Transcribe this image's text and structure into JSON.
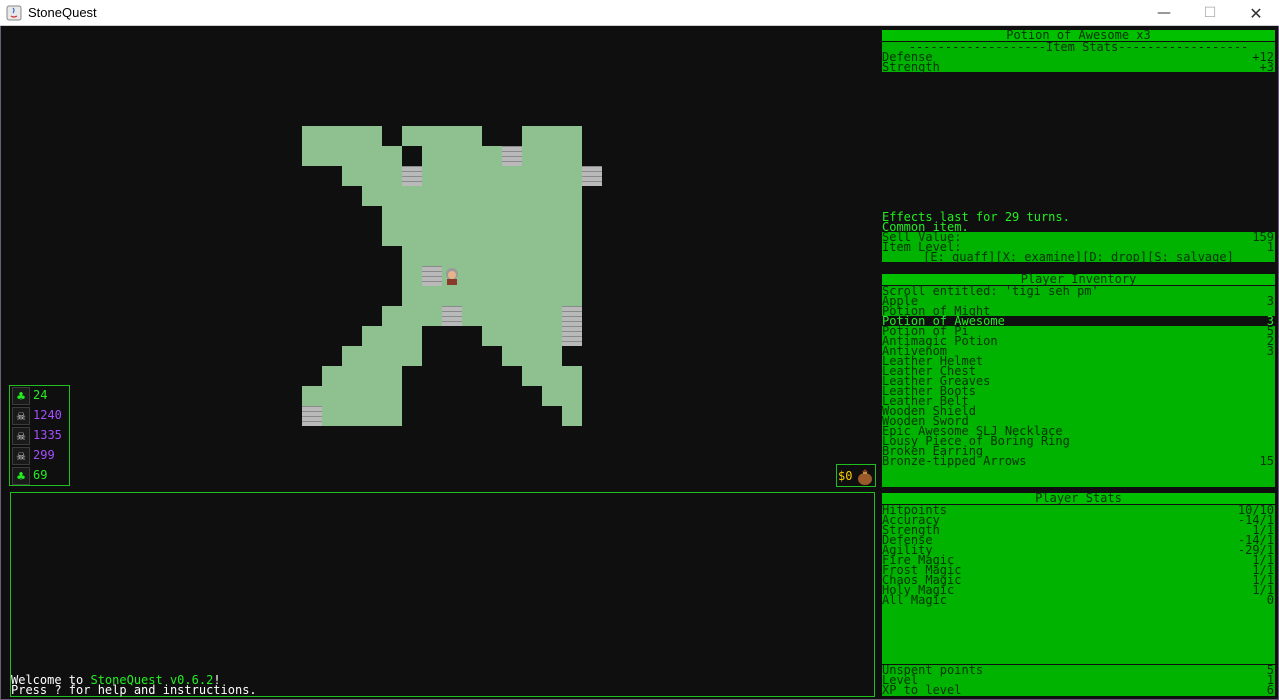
{
  "window": {
    "title": "StoneQuest",
    "minimize_icon": "—",
    "maximize_icon": "☐",
    "close_icon": "✕"
  },
  "status_counters": [
    {
      "icon": "grass-icon",
      "value": "24",
      "color": "#22ee22"
    },
    {
      "icon": "skull-icon",
      "value": "1240",
      "color": "#a64dff"
    },
    {
      "icon": "skull-icon",
      "value": "1335",
      "color": "#a64dff"
    },
    {
      "icon": "skull-icon",
      "value": "299",
      "color": "#a64dff"
    },
    {
      "icon": "grass-icon",
      "value": "69",
      "color": "#22ee22"
    }
  ],
  "gold": {
    "text": "$0"
  },
  "log": {
    "line1_prefix": "Welcome to ",
    "line1_highlight": "StoneQuest v0.6.2",
    "line1_suffix": "!",
    "line2": "Press ? for help and instructions."
  },
  "item_panel": {
    "title": "Potion of Awesome x3",
    "stats_divider": "-------------------Item Stats------------------",
    "stats": [
      {
        "label": "Defense",
        "value": "+12"
      },
      {
        "label": "Strength",
        "value": "+3"
      }
    ],
    "effects": "Effects last for 29 turns.",
    "rarity": "Common item.",
    "sell_label": "Sell Value:",
    "sell_value": "159",
    "level_label": "Item Level:",
    "level_value": "1",
    "actions": "[E: quaff][X: examine][D: drop][S: salvage]"
  },
  "inventory": {
    "title": "Player Inventory",
    "items": [
      {
        "name": "Scroll entitled: 'tigi seh pm'",
        "count": ""
      },
      {
        "name": "Apple",
        "count": "3"
      },
      {
        "name": "Potion of Might",
        "count": ""
      },
      {
        "name": "Potion of Awesome",
        "count": "3"
      },
      {
        "name": "Potion of Pi",
        "count": "5"
      },
      {
        "name": "Antimagic Potion",
        "count": "2"
      },
      {
        "name": "Antivenom",
        "count": "3"
      },
      {
        "name": "Leather Helmet",
        "count": ""
      },
      {
        "name": "Leather Chest",
        "count": ""
      },
      {
        "name": "Leather Greaves",
        "count": ""
      },
      {
        "name": "Leather Boots",
        "count": ""
      },
      {
        "name": "Leather Belt",
        "count": ""
      },
      {
        "name": "Wooden Shield",
        "count": ""
      },
      {
        "name": "Wooden Sword",
        "count": ""
      },
      {
        "name": "Epic Awesome SLJ Necklace",
        "count": ""
      },
      {
        "name": "Lousy Piece of Boring Ring",
        "count": ""
      },
      {
        "name": "Broken Earring",
        "count": ""
      },
      {
        "name": "Bronze-tipped Arrows",
        "count": "15"
      }
    ],
    "selected_index": 3
  },
  "player_stats": {
    "title": "Player Stats",
    "stats": [
      {
        "label": "Hitpoints",
        "value": "10/10"
      },
      {
        "label": "Accuracy",
        "value": "-14/1"
      },
      {
        "label": "Strength",
        "value": "1/1"
      },
      {
        "label": "Defense",
        "value": "-14/1"
      },
      {
        "label": "Agility",
        "value": "-29/1"
      },
      {
        "label": "Fire Magic",
        "value": "1/1"
      },
      {
        "label": "Frost Magic",
        "value": "1/1"
      },
      {
        "label": "Chaos Magic",
        "value": "1/1"
      },
      {
        "label": "Holy Magic",
        "value": "1/1"
      },
      {
        "label": "All Magic",
        "value": "0"
      }
    ],
    "footer": [
      {
        "label": "Unspent points",
        "value": "5"
      },
      {
        "label": "Level",
        "value": "1"
      },
      {
        "label": "XP to level",
        "value": "6"
      }
    ]
  }
}
